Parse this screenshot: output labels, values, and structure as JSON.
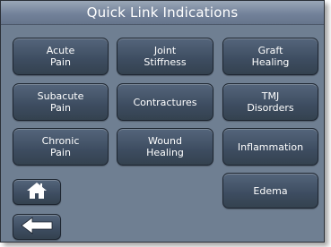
{
  "header": {
    "title": "Quick Link Indications"
  },
  "buttons": {
    "acute_pain": [
      "Acute",
      "Pain"
    ],
    "joint_stiffness": [
      "Joint",
      "Stiffness"
    ],
    "graft_healing": [
      "Graft",
      "Healing"
    ],
    "subacute_pain": [
      "Subacute",
      "Pain"
    ],
    "contractures": [
      "Contractures"
    ],
    "tmj_disorders": [
      "TMJ",
      "Disorders"
    ],
    "chronic_pain": [
      "Chronic",
      "Pain"
    ],
    "wound_healing": [
      "Wound",
      "Healing"
    ],
    "inflammation": [
      "Inflammation"
    ],
    "edema": [
      "Edema"
    ]
  },
  "nav": {
    "home_icon": "home-icon",
    "back_icon": "back-arrow-icon"
  },
  "colors": {
    "background": "#6f7f92",
    "button": "#3d4c60",
    "header": "#73829a",
    "text": "#ffffff"
  }
}
